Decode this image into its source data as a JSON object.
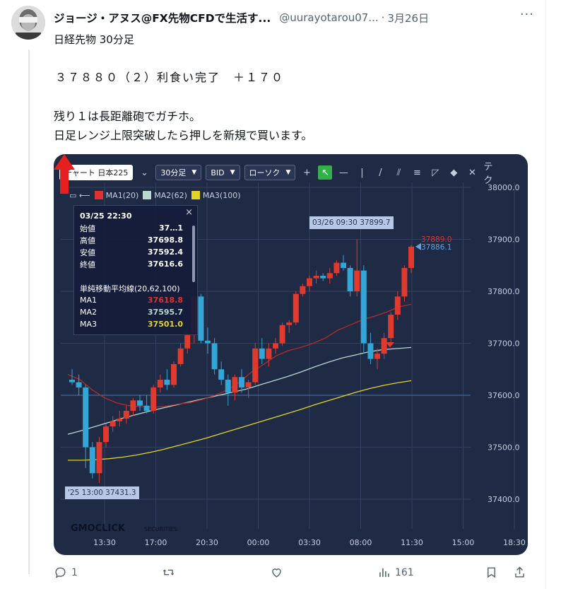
{
  "post": {
    "display_name": "ジョージ・アヌス@FX先物CFDで生活す...",
    "handle": "@uurayotarou07...",
    "separator": "·",
    "date": "3月26日",
    "more": "···",
    "lines": [
      "日経先物 30分足",
      "３７８８０（２）利食い完了　＋１７０",
      "残り１は長距離砲でガチホ。",
      "日足レンジ上限突破したら押しを新規で買います。"
    ]
  },
  "chart_toolbar": {
    "symbol": "チャート 日本225",
    "timeframe": "30分足",
    "price_type": "BID",
    "chart_style": "ローソク",
    "tool_more": "テク"
  },
  "legend": {
    "ma1": "MA1(20)",
    "ma2": "MA2(62)",
    "ma3": "MA3(100)",
    "ma1_color": "#e03030",
    "ma2_color": "#b8d8d0",
    "ma3_color": "#e0d42a"
  },
  "tooltip": {
    "datetime": "03/25 22:30",
    "open_label": "始値",
    "open_value": "37…1",
    "high_label": "高値",
    "high_value": "37698.8",
    "low_label": "安値",
    "low_value": "37592.4",
    "close_label": "終値",
    "close_value": "37616.6",
    "ma_header": "単純移動平均線(20,62,100)",
    "ma1_label": "MA1",
    "ma1_value": "37618.8",
    "ma2_label": "MA2",
    "ma2_value": "37595.7",
    "ma3_label": "MA3",
    "ma3_value": "37501.0",
    "close_icon": "×"
  },
  "callouts": {
    "high": "03/26 09:30 37899.7",
    "low": "'25 13:00 37431.3",
    "price_red": "37889.0",
    "price_blue": "37886.1"
  },
  "brand": {
    "main": "GMOCLICK",
    "sub": "SECURITIES"
  },
  "chart_data": {
    "type": "candlestick",
    "y_range": [
      37360,
      38000
    ],
    "y_ticks": [
      "38000.0",
      "37900.0",
      "37800.0",
      "37700.0",
      "37600.0",
      "37500.0",
      "37400.0"
    ],
    "x_ticks": [
      "13:30",
      "17:00",
      "20:30",
      "00:00",
      "03:30",
      "08:00",
      "11:30",
      "15:00",
      "18:30"
    ],
    "candles": [
      [
        37630,
        37650,
        37620,
        37625
      ],
      [
        37625,
        37640,
        37600,
        37615
      ],
      [
        37615,
        37620,
        37460,
        37500
      ],
      [
        37500,
        37510,
        37440,
        37450
      ],
      [
        37450,
        37520,
        37431,
        37510
      ],
      [
        37510,
        37545,
        37500,
        37540
      ],
      [
        37540,
        37560,
        37530,
        37550
      ],
      [
        37550,
        37570,
        37540,
        37555
      ],
      [
        37555,
        37580,
        37545,
        37570
      ],
      [
        37570,
        37595,
        37560,
        37590
      ],
      [
        37590,
        37600,
        37570,
        37580
      ],
      [
        37580,
        37600,
        37565,
        37570
      ],
      [
        37570,
        37620,
        37565,
        37615
      ],
      [
        37615,
        37640,
        37605,
        37630
      ],
      [
        37630,
        37650,
        37610,
        37620
      ],
      [
        37620,
        37665,
        37615,
        37660
      ],
      [
        37660,
        37700,
        37655,
        37690
      ],
      [
        37690,
        37730,
        37680,
        37720
      ],
      [
        37720,
        37800,
        37700,
        37790
      ],
      [
        37790,
        37795,
        37700,
        37705
      ],
      [
        37705,
        37730,
        37680,
        37700
      ],
      [
        37700,
        37710,
        37640,
        37650
      ],
      [
        37650,
        37665,
        37620,
        37630
      ],
      [
        37630,
        37640,
        37580,
        37605
      ],
      [
        37605,
        37640,
        37590,
        37635
      ],
      [
        37635,
        37650,
        37605,
        37615
      ],
      [
        37615,
        37630,
        37595,
        37625
      ],
      [
        37625,
        37700,
        37620,
        37690
      ],
      [
        37690,
        37710,
        37660,
        37670
      ],
      [
        37670,
        37700,
        37655,
        37690
      ],
      [
        37690,
        37710,
        37680,
        37700
      ],
      [
        37700,
        37740,
        37695,
        37735
      ],
      [
        37735,
        37745,
        37720,
        37740
      ],
      [
        37740,
        37800,
        37735,
        37795
      ],
      [
        37795,
        37815,
        37790,
        37810
      ],
      [
        37810,
        37830,
        37800,
        37825
      ],
      [
        37825,
        37840,
        37815,
        37830
      ],
      [
        37830,
        37835,
        37820,
        37825
      ],
      [
        37825,
        37845,
        37815,
        37835
      ],
      [
        37835,
        37860,
        37830,
        37855
      ],
      [
        37855,
        37870,
        37840,
        37845
      ],
      [
        37845,
        37850,
        37790,
        37800
      ],
      [
        37800,
        37899.7,
        37790,
        37840
      ],
      [
        37840,
        37850,
        37680,
        37700
      ],
      [
        37700,
        37720,
        37660,
        37670
      ],
      [
        37670,
        37690,
        37650,
        37680
      ],
      [
        37680,
        37720,
        37670,
        37710
      ],
      [
        37710,
        37760,
        37700,
        37755
      ],
      [
        37755,
        37800,
        37745,
        37790
      ],
      [
        37790,
        37850,
        37780,
        37845
      ],
      [
        37845,
        37889,
        37835,
        37886
      ]
    ],
    "ma1": [
      37640,
      37630,
      37610,
      37595,
      37585,
      37580,
      37578,
      37577,
      37579,
      37583,
      37586,
      37592,
      37600,
      37610,
      37625,
      37645,
      37660,
      37676,
      37686,
      37692,
      37700,
      37710,
      37725,
      37735,
      37745,
      37752,
      37760,
      37770,
      37775
    ],
    "ma2": [
      37525,
      37532,
      37540,
      37548,
      37556,
      37563,
      37570,
      37576,
      37582,
      37588,
      37594,
      37600,
      37606,
      37612,
      37620,
      37628,
      37636,
      37645,
      37655,
      37664,
      37672,
      37678,
      37684,
      37688,
      37690,
      37692
    ],
    "ma3": [
      37475,
      37475,
      37476,
      37478,
      37481,
      37485,
      37490,
      37496,
      37503,
      37510,
      37517,
      37525,
      37533,
      37541,
      37549,
      37557,
      37565,
      37573,
      37582,
      37590,
      37598,
      37606,
      37613,
      37619,
      37624,
      37628
    ]
  },
  "actions": {
    "reply_count": "1",
    "views_count": "161"
  }
}
